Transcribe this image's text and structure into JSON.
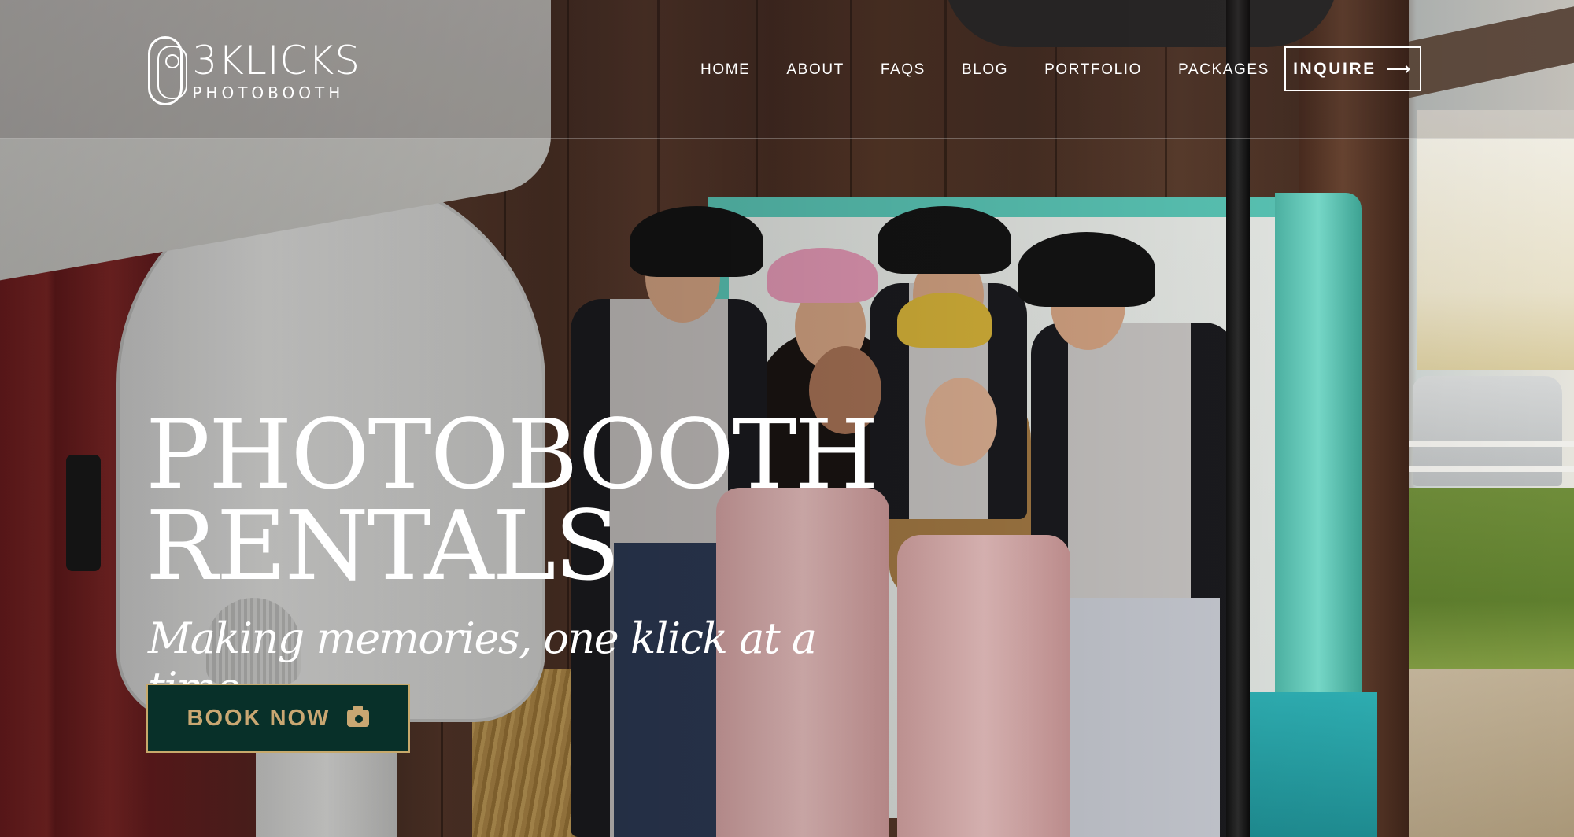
{
  "brand": {
    "name": "3KLICKS",
    "tagline": "PHOTOBOOTH"
  },
  "nav": {
    "items": [
      {
        "label": "HOME"
      },
      {
        "label": "ABOUT"
      },
      {
        "label": "FAQS"
      },
      {
        "label": "BLOG"
      },
      {
        "label": "PORTFOLIO"
      },
      {
        "label": "PACKAGES"
      }
    ],
    "cta_label": "INQUIRE",
    "cta_icon": "arrow-right-icon"
  },
  "hero": {
    "title_line1": "PHOTOBOOTH",
    "title_line2": "RENTALS",
    "tagline": "Making memories, one klick at a time",
    "button_label": "BOOK NOW",
    "button_icon": "camera-icon"
  },
  "colors": {
    "button_bg": "#083029",
    "button_text": "#c9a772",
    "button_border": "#c7a96b",
    "header_text": "#ffffff"
  }
}
